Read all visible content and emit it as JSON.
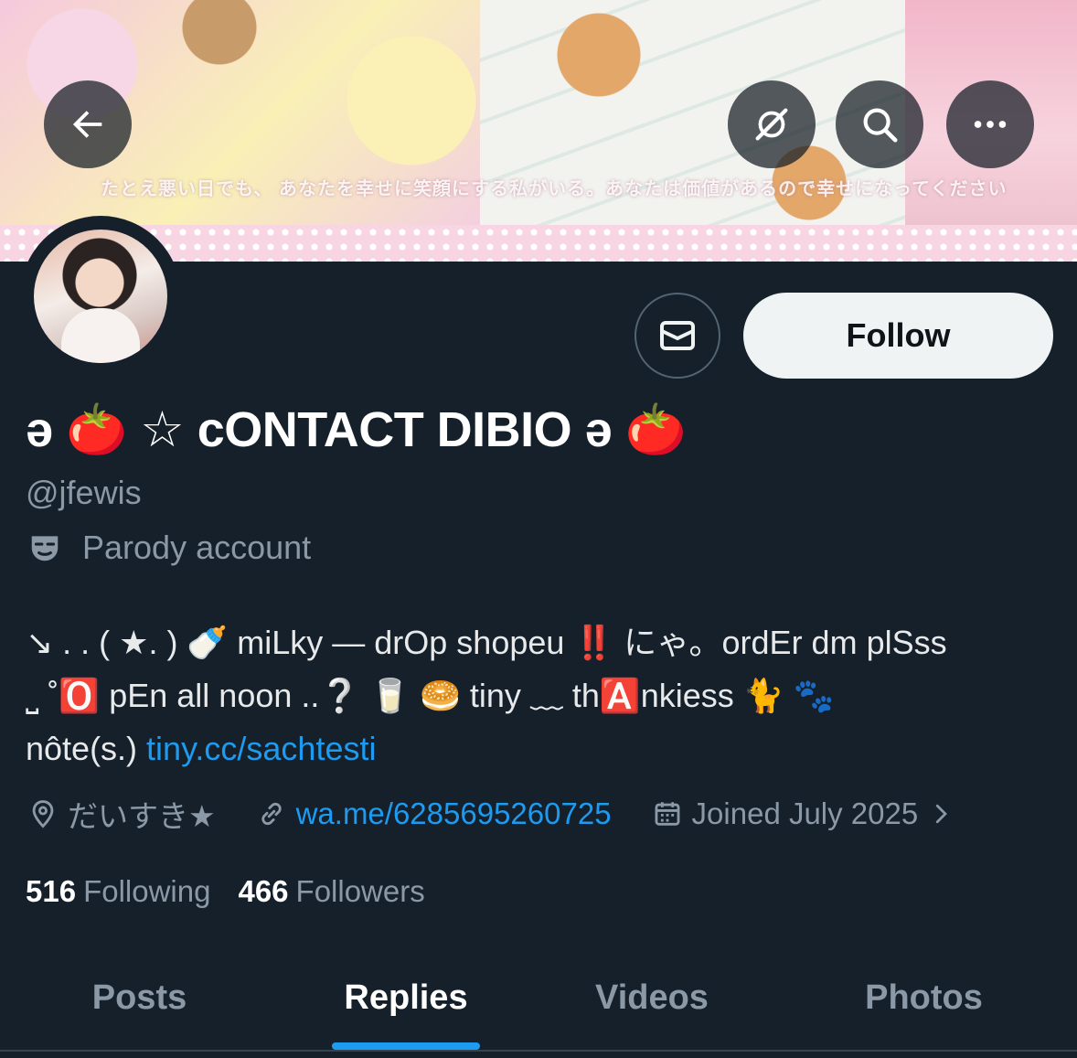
{
  "banner": {
    "caption": "たとえ悪い日でも、 あなたを幸せに笑顔にする私がいる。あなたは価値があるので幸せになってください"
  },
  "buttons": {
    "back_icon": "arrow-left-icon",
    "grok_icon": "grok-icon",
    "search_icon": "search-icon",
    "more_icon": "more-icon",
    "message_icon": "envelope-icon",
    "follow_label": "Follow"
  },
  "profile": {
    "display_name": "ə 🍅 ☆ cONTACT DIBIO ə 🍅",
    "handle": "@jfewis",
    "parody_label": "Parody account",
    "bio": {
      "line1": "↘ . . ( ★. ) 🍼 miLky — drOp shopeu ‼️ にゃ。ordEr dm plSss",
      "line2": "⎵ ˚🅾️ pEn all noon ..❔ 🥛 🥯 tiny ﹏ th🅰️nkiess 🐈 🐾",
      "line3_text": "nôte(s.) ",
      "line3_link": "tiny.cc/sachtesti"
    },
    "location": "だいすき★",
    "website": "wa.me/6285695260725",
    "joined": "Joined July 2025"
  },
  "stats": {
    "following_count": "516",
    "following_label": "Following",
    "followers_count": "466",
    "followers_label": "Followers"
  },
  "tabs": [
    {
      "label": "Posts",
      "active": false
    },
    {
      "label": "Replies",
      "active": true
    },
    {
      "label": "Videos",
      "active": false
    },
    {
      "label": "Photos",
      "active": false
    }
  ],
  "colors": {
    "background": "#15202b",
    "accent": "#1d9bf0",
    "muted_text": "#8b98a5",
    "follow_button_bg": "#eff3f4"
  }
}
